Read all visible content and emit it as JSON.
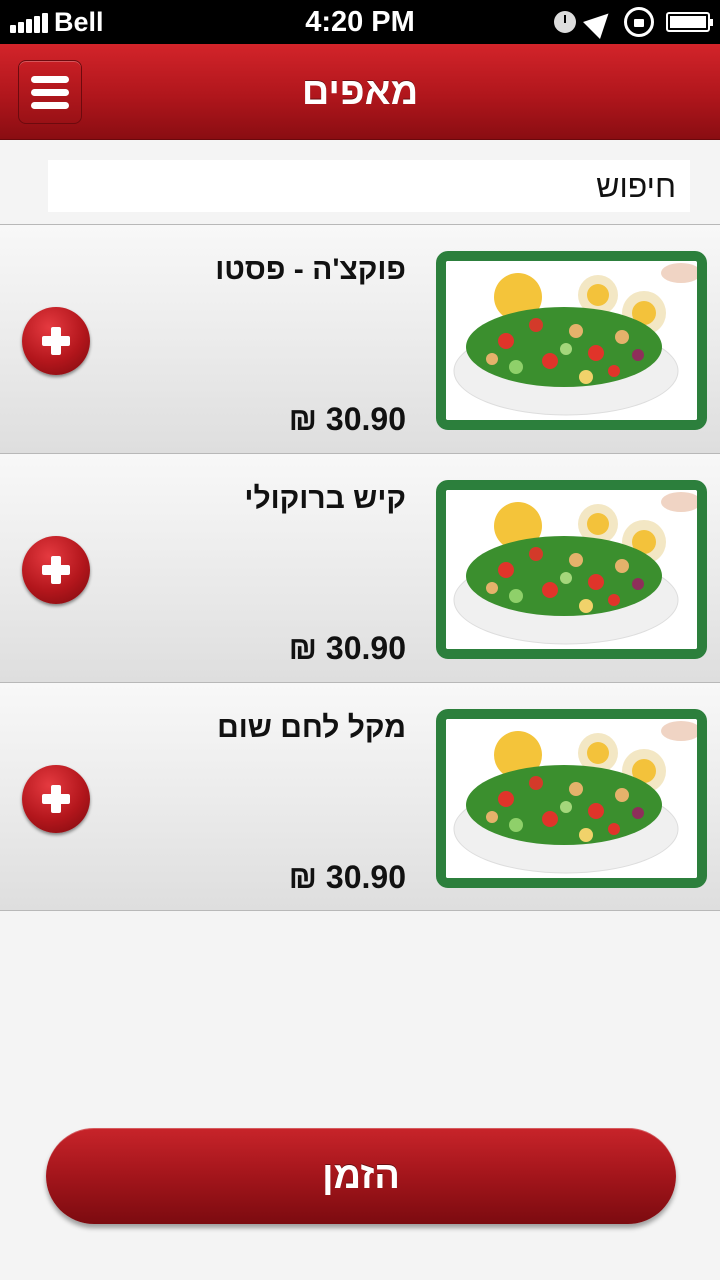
{
  "status_bar": {
    "carrier": "Bell",
    "time": "4:20 PM",
    "signal_icon": "signal-bars-icon",
    "icons": [
      "clock-icon",
      "location-arrow-icon",
      "rotation-lock-icon",
      "battery-icon"
    ]
  },
  "header": {
    "title": "מאפים",
    "menu_icon": "hamburger-menu-icon",
    "color": "#b0161c"
  },
  "search": {
    "placeholder": "חיפוש",
    "value": ""
  },
  "items": [
    {
      "name": "פוקצ'ה - פסטו",
      "price": "30.90 ₪",
      "image": "salad-photo",
      "add_icon": "plus-icon"
    },
    {
      "name": "קיש ברוקולי",
      "price": "30.90 ₪",
      "image": "salad-photo",
      "add_icon": "plus-icon"
    },
    {
      "name": "מקל לחם שום",
      "price": "30.90 ₪",
      "image": "salad-photo",
      "add_icon": "plus-icon"
    }
  ],
  "order_button": {
    "label": "הזמן"
  },
  "colors": {
    "accent_red": "#b0161c",
    "photo_frame_green": "#2c7f3c"
  }
}
